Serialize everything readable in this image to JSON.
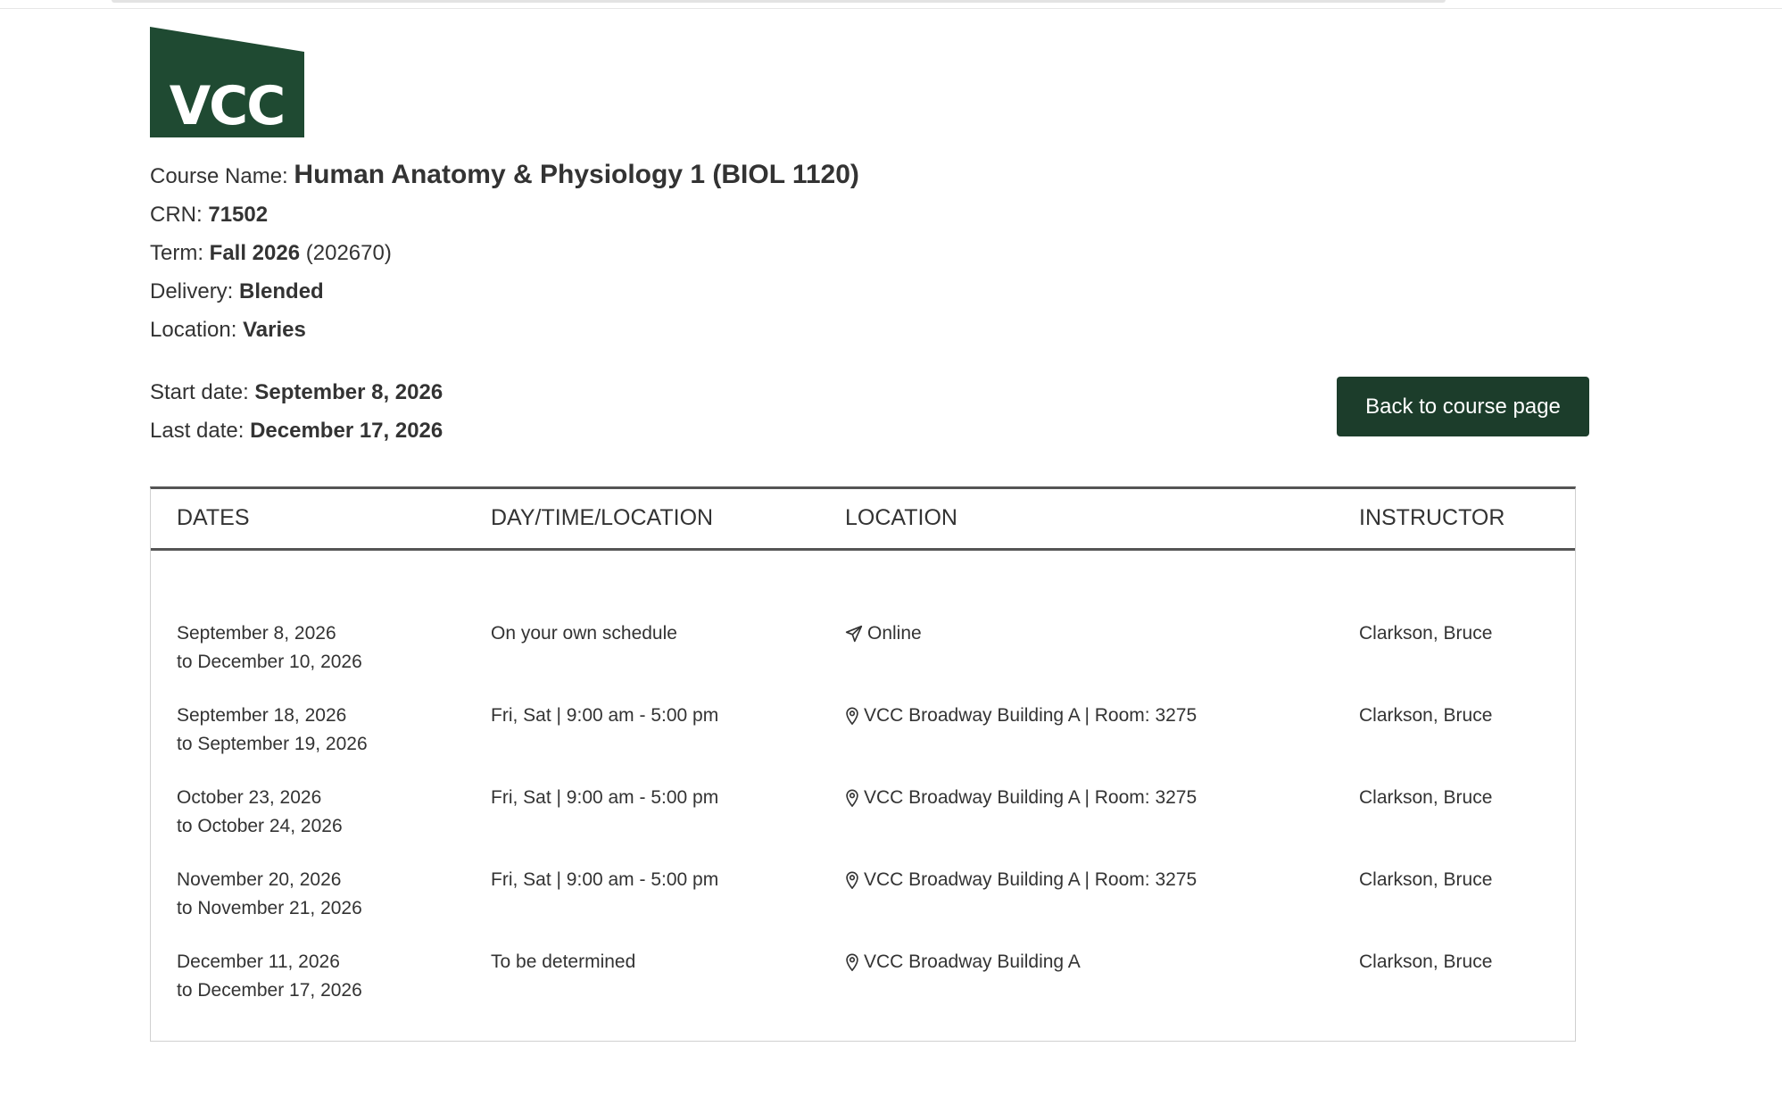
{
  "logo": {
    "text": "VCC",
    "color": "#1f4a32"
  },
  "course": {
    "name_label": "Course Name:",
    "name": "Human Anatomy & Physiology 1 (BIOL 1120)",
    "crn_label": "CRN:",
    "crn": "71502",
    "term_label": "Term:",
    "term": "Fall 2026",
    "term_code": "(202670)",
    "delivery_label": "Delivery:",
    "delivery": "Blended",
    "location_label": "Location:",
    "location": "Varies"
  },
  "dates": {
    "start_label": "Start date:",
    "start": "September 8, 2026",
    "last_label": "Last date:",
    "last": "December 17, 2026"
  },
  "actions": {
    "back_label": "Back to course page",
    "back_color": "#1c3d2b"
  },
  "table": {
    "headers": [
      "DATES",
      "DAY/TIME/LOCATION",
      "LOCATION",
      "INSTRUCTOR"
    ],
    "rows": [
      {
        "date_from": "September 8, 2026",
        "date_to": "to December 10, 2026",
        "daytime": "On your own schedule",
        "location_icon": "paper-plane-icon",
        "location": "Online",
        "instructor": "Clarkson, Bruce"
      },
      {
        "date_from": "September 18, 2026",
        "date_to": "to September 19, 2026",
        "daytime": "Fri, Sat | 9:00 am - 5:00 pm",
        "location_icon": "map-pin-icon",
        "location": "VCC Broadway Building A | Room: 3275",
        "instructor": "Clarkson, Bruce"
      },
      {
        "date_from": "October 23, 2026",
        "date_to": "to October 24, 2026",
        "daytime": "Fri, Sat | 9:00 am - 5:00 pm",
        "location_icon": "map-pin-icon",
        "location": "VCC Broadway Building A | Room: 3275",
        "instructor": "Clarkson, Bruce"
      },
      {
        "date_from": "November 20, 2026",
        "date_to": "to November 21, 2026",
        "daytime": "Fri, Sat | 9:00 am - 5:00 pm",
        "location_icon": "map-pin-icon",
        "location": "VCC Broadway Building A | Room: 3275",
        "instructor": "Clarkson, Bruce"
      },
      {
        "date_from": "December 11, 2026",
        "date_to": "to December 17, 2026",
        "daytime": "To be determined",
        "location_icon": "map-pin-icon",
        "location": "VCC Broadway Building A",
        "instructor": "Clarkson, Bruce"
      }
    ]
  }
}
